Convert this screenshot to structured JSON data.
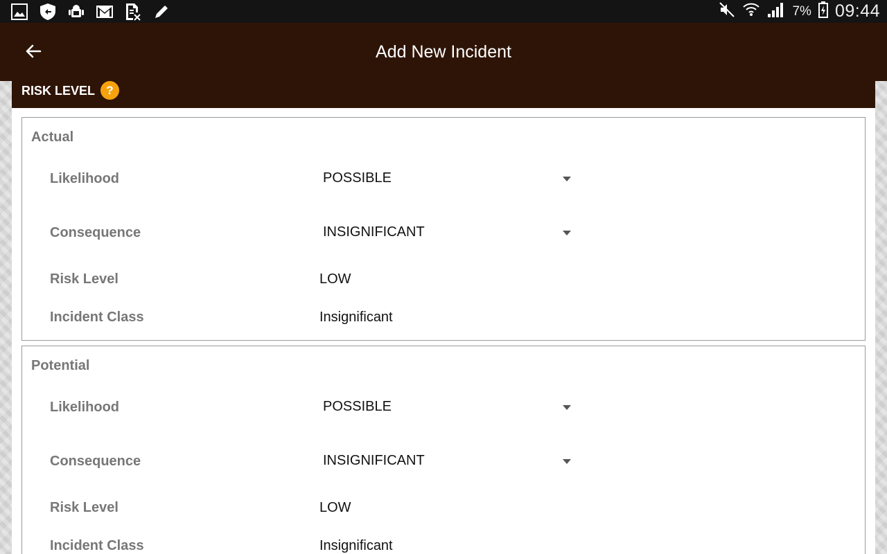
{
  "status_bar": {
    "icons": [
      "gallery-icon",
      "shield-sync-icon",
      "android-debug-icon",
      "gmail-icon",
      "document-icon",
      "edit-icon"
    ],
    "right_icons": [
      "mute-icon",
      "wifi-icon",
      "signal-icon",
      "battery-icon"
    ],
    "battery": "7%",
    "time": "09:44"
  },
  "app_bar": {
    "title": "Add New Incident",
    "back_icon": "arrow-back-icon"
  },
  "section": {
    "title": "RISK LEVEL",
    "help": "?"
  },
  "actual": {
    "title": "Actual",
    "likelihood_label": "Likelihood",
    "likelihood_value": "POSSIBLE",
    "consequence_label": "Consequence",
    "consequence_value": "INSIGNIFICANT",
    "risk_label": "Risk Level",
    "risk_value": "LOW",
    "class_label": "Incident Class",
    "class_value": "Insignificant"
  },
  "potential": {
    "title": "Potential",
    "likelihood_label": "Likelihood",
    "likelihood_value": "POSSIBLE",
    "consequence_label": "Consequence",
    "consequence_value": "INSIGNIFICANT",
    "risk_label": "Risk Level",
    "risk_value": "LOW",
    "class_label": "Incident Class",
    "class_value": "Insignificant"
  },
  "colors": {
    "header_bg": "#2e1407",
    "help_badge": "#f7a20d",
    "status_bar": "#141414"
  }
}
